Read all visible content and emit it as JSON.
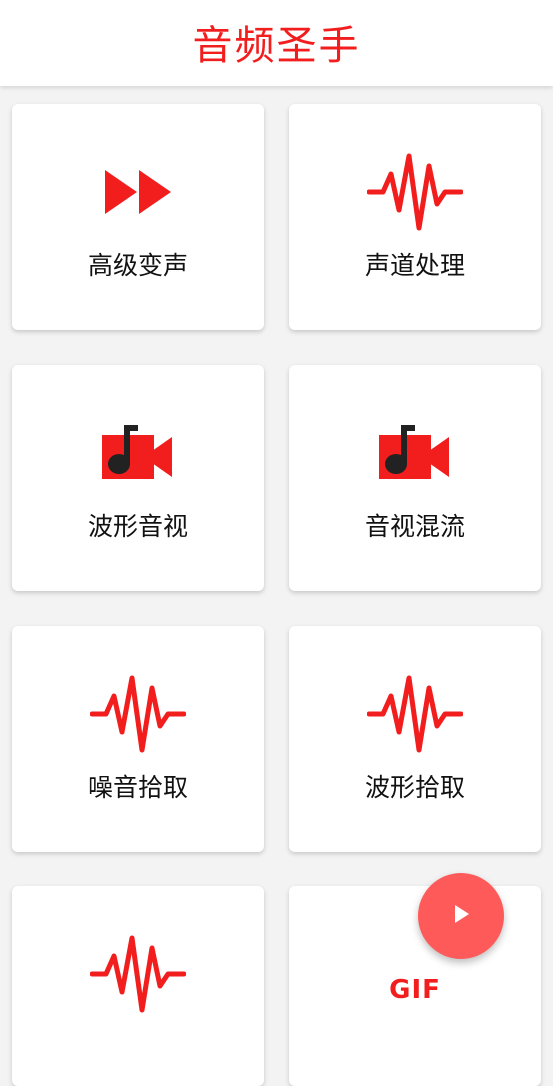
{
  "app": {
    "title": "音频圣手"
  },
  "colors": {
    "accent": "#f21e1e",
    "fab": "#ff5a5a"
  },
  "tools": [
    {
      "label": "高级变声",
      "icon": "fast-forward-icon"
    },
    {
      "label": "声道处理",
      "icon": "waveform-icon"
    },
    {
      "label": "波形音视",
      "icon": "music-video-icon"
    },
    {
      "label": "音视混流",
      "icon": "music-video-icon"
    },
    {
      "label": "噪音拾取",
      "icon": "waveform-icon"
    },
    {
      "label": "波形拾取",
      "icon": "waveform-icon"
    },
    {
      "label": "",
      "icon": "waveform-icon"
    },
    {
      "label": "",
      "icon": "gif-icon",
      "icon_text": "GIF"
    }
  ],
  "fab": {
    "icon": "play-icon"
  }
}
